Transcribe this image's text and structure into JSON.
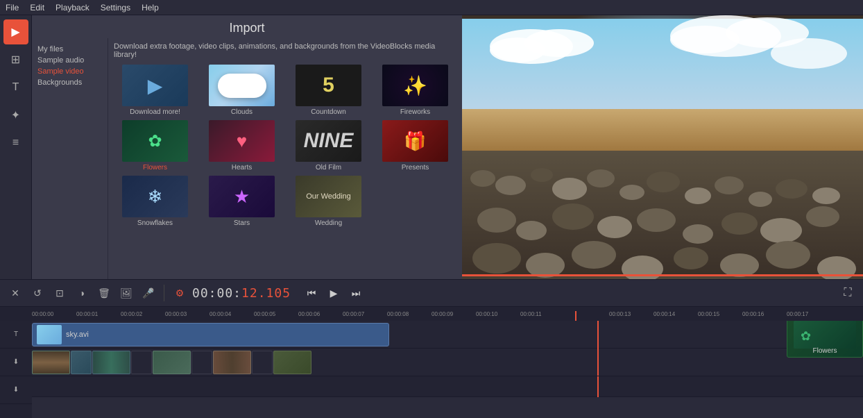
{
  "menubar": {
    "items": [
      "File",
      "Edit",
      "Playback",
      "Settings",
      "Help"
    ]
  },
  "sidebar": {
    "icons": [
      {
        "name": "video-icon",
        "symbol": "▶",
        "active": true
      },
      {
        "name": "text-icon",
        "symbol": "T",
        "active": false
      },
      {
        "name": "effect-icon",
        "symbol": "✦",
        "active": false
      },
      {
        "name": "menu-icon",
        "symbol": "≡",
        "active": false
      },
      {
        "name": "media-icon",
        "symbol": "⊞",
        "active": false
      }
    ]
  },
  "import": {
    "title": "Import",
    "description": "Download extra footage, video clips, animations, and backgrounds from the VideoBlocks media library!",
    "filetree": [
      {
        "label": "My files",
        "selected": false
      },
      {
        "label": "Sample audio",
        "selected": false
      },
      {
        "label": "Sample video",
        "selected": true
      },
      {
        "label": "Backgrounds",
        "selected": false
      }
    ],
    "grid_items": [
      {
        "id": "download",
        "label": "Download more!",
        "type": "download"
      },
      {
        "id": "clouds",
        "label": "Clouds",
        "type": "clouds"
      },
      {
        "id": "countdown",
        "label": "Countdown",
        "type": "countdown"
      },
      {
        "id": "fireworks",
        "label": "Fireworks",
        "type": "fireworks"
      },
      {
        "id": "flowers",
        "label": "Flowers",
        "type": "flowers",
        "selected": true
      },
      {
        "id": "hearts",
        "label": "Hearts",
        "type": "hearts"
      },
      {
        "id": "oldfilm",
        "label": "Old Film",
        "type": "oldfilm"
      },
      {
        "id": "presents",
        "label": "Presents",
        "type": "presents"
      },
      {
        "id": "snowflakes",
        "label": "Snowflakes",
        "type": "snowflakes"
      },
      {
        "id": "stars",
        "label": "Stars",
        "type": "stars"
      },
      {
        "id": "wedding",
        "label": "Wedding",
        "type": "wedding"
      }
    ]
  },
  "toolbar": {
    "buttons": [
      {
        "name": "close-button",
        "symbol": "✕"
      },
      {
        "name": "undo-button",
        "symbol": "↺"
      },
      {
        "name": "crop-button",
        "symbol": "⊡"
      },
      {
        "name": "contrast-button",
        "symbol": "◑"
      },
      {
        "name": "delete-button",
        "symbol": "🗑"
      },
      {
        "name": "image-button",
        "symbol": "🖼"
      },
      {
        "name": "audio-button",
        "symbol": "🎤"
      },
      {
        "name": "settings-button",
        "symbol": "⚙",
        "red": true
      }
    ],
    "time": "00:00:",
    "time_red": "12.105"
  },
  "playback": {
    "buttons": [
      {
        "name": "rewind-button",
        "symbol": "⏮"
      },
      {
        "name": "play-button",
        "symbol": "▶"
      },
      {
        "name": "forward-button",
        "symbol": "⏭"
      }
    ],
    "fullscreen_symbol": "⛶"
  },
  "timeline": {
    "ruler_marks": [
      "00:00:00",
      "00:00:01",
      "00:00:02",
      "00:00:03",
      "00:00:04",
      "00:00:05",
      "00:00:06",
      "00:00:07",
      "00:00:08",
      "00:00:09",
      "00:00:10",
      "00:00:11",
      "",
      "00:00:13",
      "00:00:14",
      "00:00:15",
      "00:00:16",
      "00:00:17"
    ],
    "playhead_pct": "68%",
    "video_clip": {
      "name": "sky.avi",
      "width_pct": "43%"
    },
    "flowers_clip": {
      "label": "Flowers"
    },
    "track_icons": [
      "T",
      "⬇"
    ]
  }
}
